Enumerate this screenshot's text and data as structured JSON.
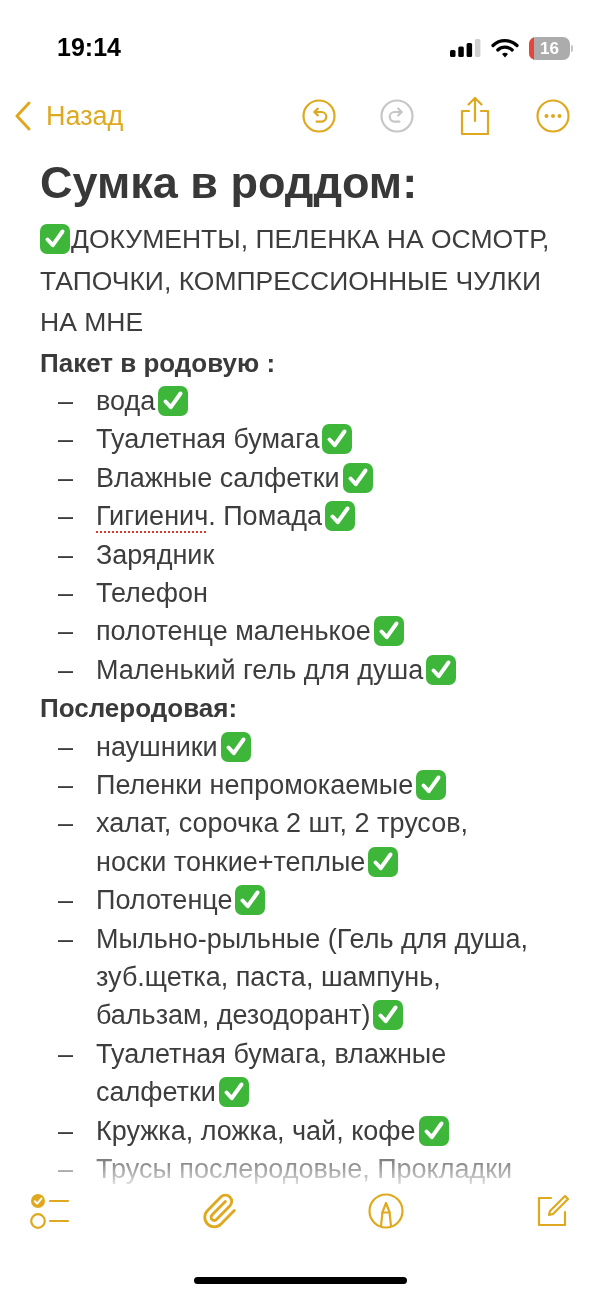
{
  "status_bar": {
    "time": "19:14",
    "battery": "16"
  },
  "nav": {
    "back": "Назад",
    "actions": [
      {
        "kind": "undo",
        "disabled": false
      },
      {
        "kind": "redo",
        "disabled": true
      },
      {
        "kind": "share",
        "disabled": false
      },
      {
        "kind": "more",
        "disabled": false
      }
    ]
  },
  "note": {
    "title": "Сумка в роддом:",
    "blocks": [
      {
        "kind": "paragraph",
        "checked": true,
        "text": "ДОКУМЕНТЫ, ПЕЛЕНКА НА ОСМОТР, ТАПОЧКИ, КОМПРЕССИОННЫЕ ЧУЛКИ НА МНЕ"
      },
      {
        "kind": "heading",
        "text": "Пакет в родовую :"
      },
      {
        "kind": "list",
        "items": [
          {
            "marker": "–",
            "text": "вода",
            "checked": true
          },
          {
            "marker": "–",
            "text": "Туалетная бумага",
            "checked": true
          },
          {
            "marker": "–",
            "text": "Влажные салфетки",
            "checked": true
          },
          {
            "marker": "–",
            "parts": [
              {
                "text": "Гигиенич",
                "misspelled": true
              },
              {
                "text": ". Помада",
                "misspelled": false
              }
            ],
            "checked": true
          },
          {
            "marker": "–",
            "text": "Зарядник",
            "checked": false
          },
          {
            "marker": "–",
            "text": "Телефон",
            "checked": false
          },
          {
            "marker": "–",
            "text": "полотенце маленькое",
            "checked": true
          },
          {
            "marker": "–",
            "text": "Маленький гель для душа",
            "checked": true
          }
        ]
      },
      {
        "kind": "heading",
        "text": "Послеродовая:"
      },
      {
        "kind": "list",
        "items": [
          {
            "marker": "–",
            "text": "наушники",
            "checked": true
          },
          {
            "marker": "–",
            "text": "Пеленки непромокаемые",
            "checked": true
          },
          {
            "marker": "–",
            "text": "халат, сорочка 2 шт, 2 трусов, носки тонкие+теплые",
            "checked": true
          },
          {
            "marker": "–",
            "text": "Полотенце",
            "checked": true
          },
          {
            "marker": "–",
            "text": "Мыльно-рыльные (Гель для душа, зуб.щетка, паста, шампунь, бальзам, дезодорант)",
            "checked": true
          },
          {
            "marker": "–",
            "text": "Туалетная бумага, влажные салфетки",
            "checked": true
          },
          {
            "marker": "–",
            "text": "Кружка, ложка, чай, кофе",
            "checked": true
          },
          {
            "marker": "–",
            "text": "Трусы послеродовые, Прокладки"
          }
        ]
      }
    ]
  },
  "toolbar": [
    {
      "kind": "checklist"
    },
    {
      "kind": "attach"
    },
    {
      "kind": "markup"
    },
    {
      "kind": "compose"
    }
  ]
}
